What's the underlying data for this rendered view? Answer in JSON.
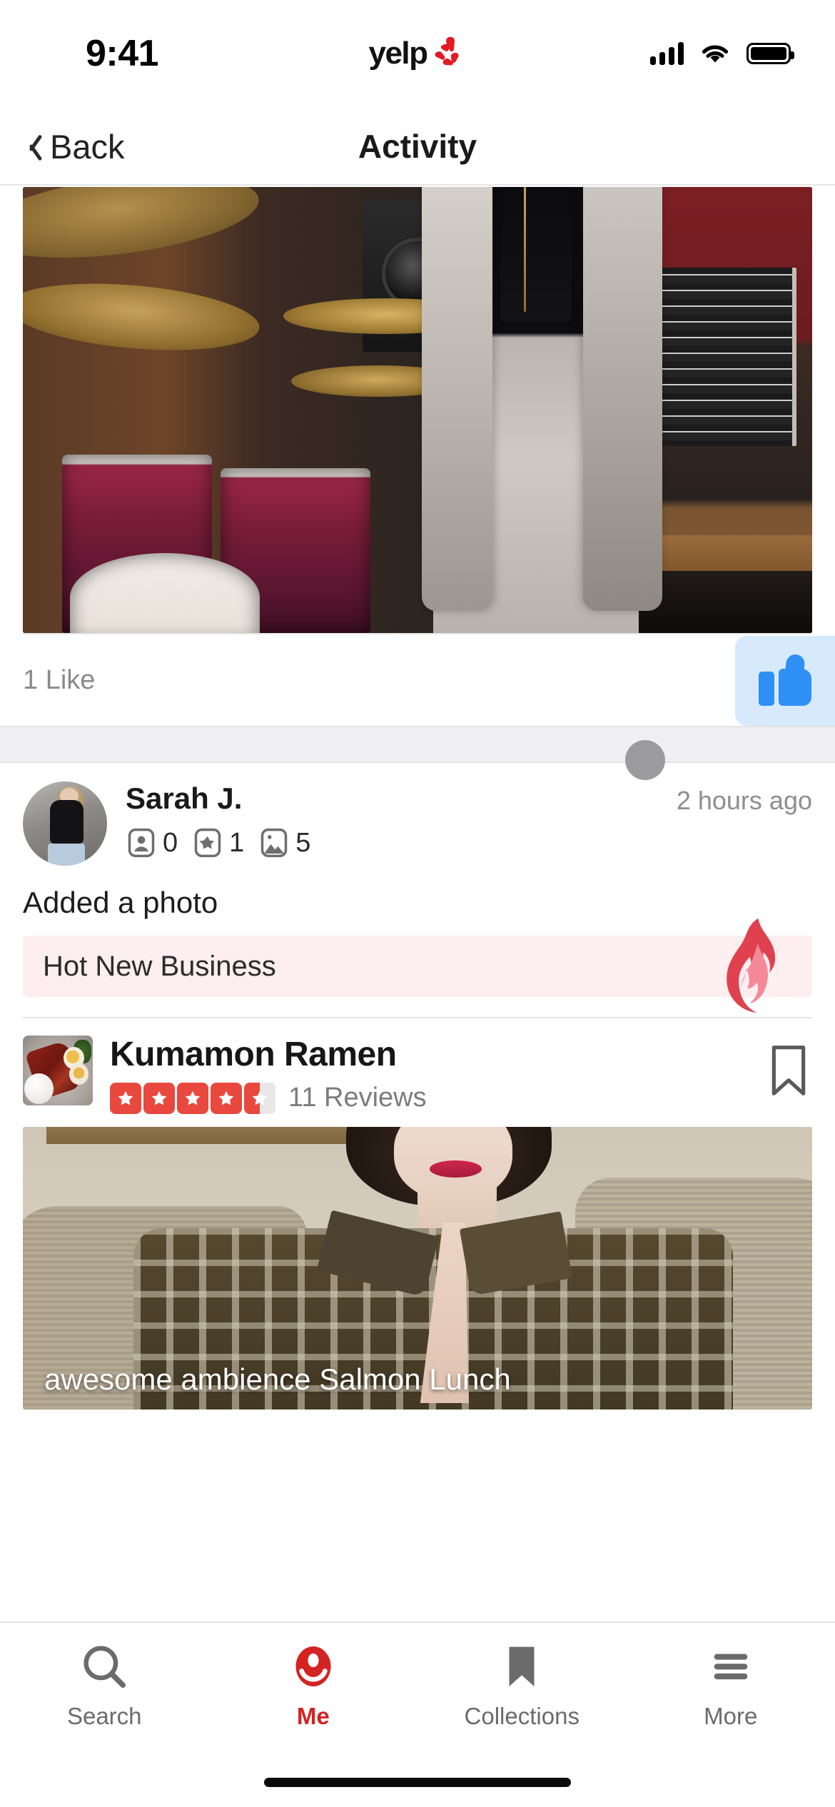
{
  "status_bar": {
    "time": "9:41",
    "brand": "yelp",
    "icons": [
      "cellular-signal-icon",
      "wifi-icon",
      "battery-icon"
    ]
  },
  "nav_bar": {
    "back_label": "Back",
    "title": "Activity",
    "back_icon": "chevron-left-icon"
  },
  "feed": {
    "previous_post": {
      "photo_alt": "music-studio-photo",
      "like_count_label": "1 Like",
      "like_button_icon": "thumbs-up-icon",
      "like_button_bg": "#d7eafd",
      "like_button_fg": "#2e90f5"
    },
    "post": {
      "user": {
        "name": "Sarah J.",
        "avatar_alt": "sarah-j-avatar",
        "stats": [
          {
            "icon": "friends-icon",
            "value": "0"
          },
          {
            "icon": "reviews-star-icon",
            "value": "1"
          },
          {
            "icon": "photos-icon",
            "value": "5"
          }
        ]
      },
      "timestamp": "2 hours ago",
      "action_text": "Added a photo",
      "badge": {
        "label": "Hot New Business",
        "icon": "flame-icon",
        "bg": "#fdeef0",
        "accent": "#e0414f"
      },
      "business": {
        "name": "Kumamon Ramen",
        "thumbnail_alt": "ramen-dish-thumbnail",
        "rating": 4.5,
        "max_rating": 5,
        "star_color": "#e8483e",
        "review_count_label": "11 Reviews",
        "bookmark_icon": "bookmark-icon"
      },
      "photo": {
        "alt": "woman-in-plaid-shirt-photo",
        "caption": "awesome ambience Salmon Lunch"
      }
    }
  },
  "tab_bar": {
    "active_color": "#d32323",
    "inactive_color": "#6b6b6b",
    "tabs": [
      {
        "label": "Search",
        "icon": "search-icon",
        "active": false
      },
      {
        "label": "Me",
        "icon": "me-profile-icon",
        "active": true
      },
      {
        "label": "Collections",
        "icon": "bookmark-icon",
        "active": false
      },
      {
        "label": "More",
        "icon": "hamburger-menu-icon",
        "active": false
      }
    ]
  }
}
